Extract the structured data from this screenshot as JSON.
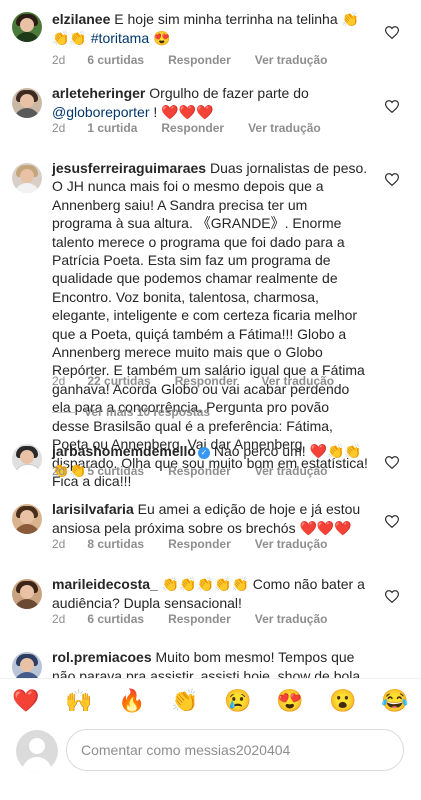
{
  "comments": [
    {
      "username": "elzilanee",
      "text": " E hoje sim minha terrinha na telinha 👏👏👏 ",
      "tag": "#toritama",
      "tail": " 😍",
      "time": "2d",
      "likes": "6 curtidas",
      "reply": "Responder",
      "translate": "Ver tradução"
    },
    {
      "username": "arleteheringer",
      "text": " Orgulho de fazer parte do ",
      "tag": "@globoreporter",
      "tail": " ! ❤️❤️❤️",
      "time": "2d",
      "likes": "1 curtida",
      "reply": "Responder",
      "translate": "Ver tradução"
    },
    {
      "username": "jesusferreiraguimaraes",
      "text": " Duas jornalistas de peso. O JH nunca mais foi o mesmo depois que a Annenberg saiu! A Sandra precisa ter um programa à sua altura. 《GRANDE》. Enorme talento merece o programa que foi dado para a Patrícia Poeta. Esta sim faz um programa de qualidade que podemos chamar realmente de Encontro. Voz bonita, talentosa, charmosa, elegante, inteligente e com certeza ficaria melhor que a Poeta, quiçá também a Fátima!!! Globo a Annenberg merece muito mais que o Globo Repórter. E também um salário igual que a Fátima ganhava! Acorda Globo ou vai acabar perdendo ela para a concorrência. Pergunta pro povão desse Brasilsão qual é a preferência: Fátima, Poeta ou Annenberg.  Vai dar Annenberg disparado. Olha que sou muito bom em estatística! Fica a dica!!!",
      "tag": "",
      "tail": "",
      "time": "2d",
      "likes": "22 curtidas",
      "reply": "Responder",
      "translate": "Ver tradução"
    },
    {
      "username": "jarbashomemdemello",
      "text": " Nao perco um! ❤️👏👏👏👏",
      "tag": "",
      "tail": "",
      "time": "2d",
      "likes": "5 curtidas",
      "reply": "Responder",
      "translate": "Ver tradução"
    },
    {
      "username": "larisilvafaria",
      "text": " Eu amei a edição de hoje e já estou ansiosa pela próxima sobre os brechós ❤️❤️❤️",
      "tag": "",
      "tail": "",
      "time": "2d",
      "likes": "8 curtidas",
      "reply": "Responder",
      "translate": "Ver tradução"
    },
    {
      "username": "marileidecosta_",
      "text": " 👏👏👏👏👏 Como não bater a audiência? Dupla sensacional!",
      "tag": "",
      "tail": "",
      "time": "2d",
      "likes": "6 curtidas",
      "reply": "Responder",
      "translate": "Ver tradução"
    },
    {
      "username": "rol.premiacoes",
      "text": " Muito bom mesmo! Tempos que não parava pra assistir, assisti hoje, show de bola !!! 👏🏿👏🏿",
      "tag": "",
      "tail": "",
      "time": "",
      "likes": "",
      "reply": "",
      "translate": ""
    }
  ],
  "more_replies": "Ver mais 10 respostas",
  "reactions": [
    "❤️",
    "🙌",
    "🔥",
    "👏",
    "😢",
    "😍",
    "😮",
    "😂"
  ],
  "compose": {
    "placeholder": "Comentar como messias2020404"
  },
  "colors": {
    "link": "#00376b",
    "verified": "#3897f0",
    "muted": "#8e8e8e"
  }
}
